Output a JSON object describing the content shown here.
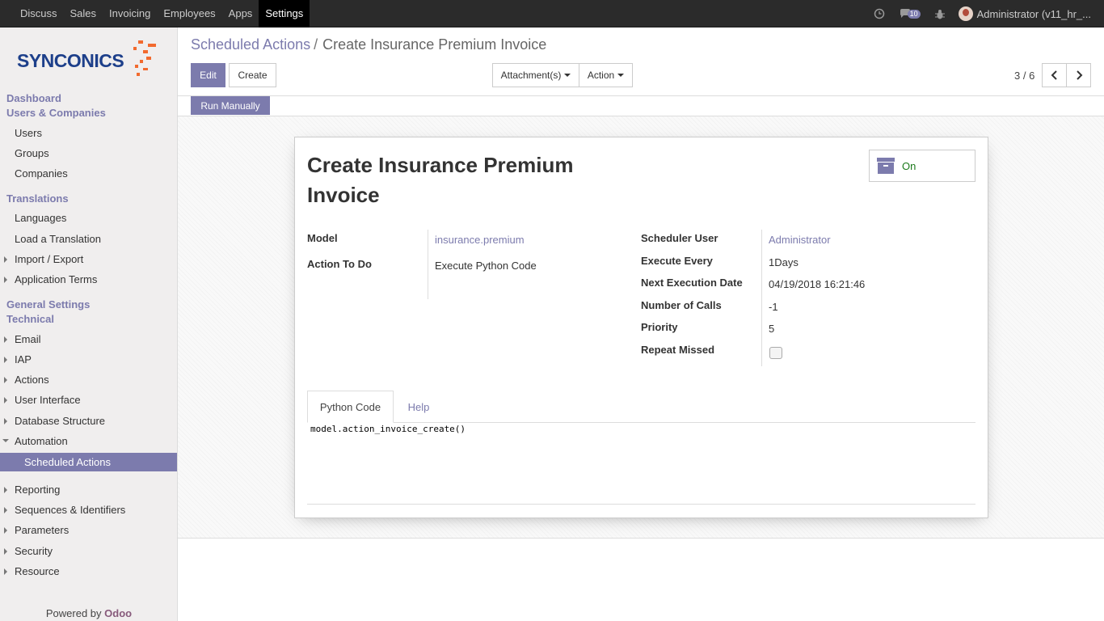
{
  "topbar": {
    "menu": [
      "Discuss",
      "Sales",
      "Invoicing",
      "Employees",
      "Apps",
      "Settings"
    ],
    "active_menu": "Settings",
    "chat_count": "10",
    "user": "Administrator (v11_hr_..."
  },
  "sidebar": {
    "logo": "SYNCONICS",
    "dashboard": "Dashboard",
    "users_companies": "Users & Companies",
    "users": "Users",
    "groups": "Groups",
    "companies": "Companies",
    "translations": "Translations",
    "languages": "Languages",
    "load_translation": "Load a Translation",
    "import_export": "Import / Export",
    "application_terms": "Application Terms",
    "general_settings": "General Settings",
    "technical": "Technical",
    "email": "Email",
    "iap": "IAP",
    "actions": "Actions",
    "user_interface": "User Interface",
    "database_structure": "Database Structure",
    "automation": "Automation",
    "scheduled_actions": "Scheduled Actions",
    "reporting": "Reporting",
    "sequences": "Sequences & Identifiers",
    "parameters": "Parameters",
    "security": "Security",
    "resource": "Resource",
    "powered_by": "Powered by",
    "powered_brand": "Odoo"
  },
  "breadcrumb": {
    "parent": "Scheduled Actions",
    "separator": "/",
    "current": "Create Insurance Premium Invoice"
  },
  "buttons": {
    "edit": "Edit",
    "create": "Create",
    "attachments": "Attachment(s)",
    "action": "Action",
    "run_manually": "Run Manually"
  },
  "pager": {
    "value": "3 / 6"
  },
  "record": {
    "title": "Create Insurance Premium Invoice",
    "active_label": "On",
    "model_label": "Model",
    "model_value": "insurance.premium",
    "action_label": "Action To Do",
    "action_value": "Execute Python Code",
    "scheduler_user_label": "Scheduler User",
    "scheduler_user_value": "Administrator",
    "execute_every_label": "Execute Every",
    "execute_every_value": "1Days",
    "next_exec_label": "Next Execution Date",
    "next_exec_value": "04/19/2018 16:21:46",
    "num_calls_label": "Number of Calls",
    "num_calls_value": "-1",
    "priority_label": "Priority",
    "priority_value": "5",
    "repeat_missed_label": "Repeat Missed",
    "repeat_missed_checked": false
  },
  "tabs": {
    "python_code": "Python Code",
    "help": "Help"
  },
  "code": "model.action_invoice_create()",
  "colors": {
    "accent": "#7c7bad",
    "navbar": "#2b2b2b",
    "active_green": "#1b7a1b"
  }
}
